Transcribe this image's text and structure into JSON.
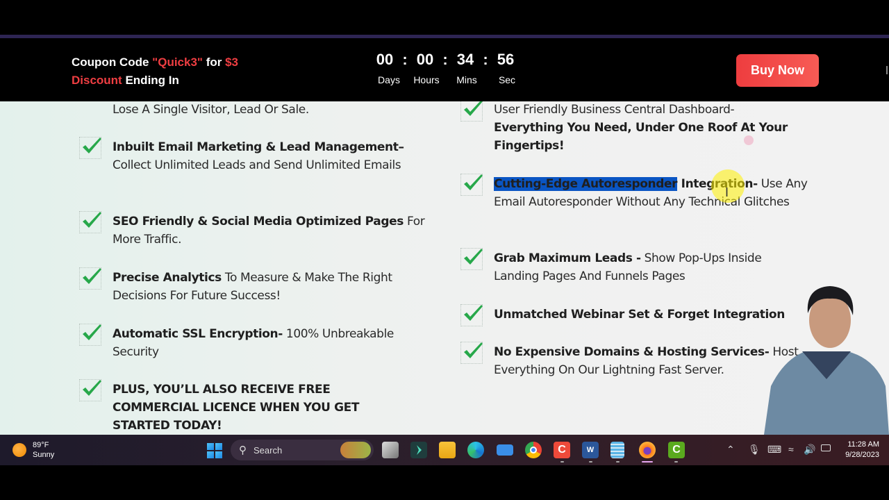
{
  "promo": {
    "coupon_prefix": "Coupon Code ",
    "coupon_code": "\"Quick3\"",
    "coupon_mid": " for ",
    "coupon_amount": "$3",
    "discount_word": "Discount",
    "coupon_suffix": " Ending In",
    "countdown": {
      "days": "00",
      "hours": "00",
      "mins": "34",
      "secs": "56",
      "separator": ":",
      "labels": [
        "Days",
        "Hours",
        "Mins",
        "Sec"
      ]
    },
    "buy_label": "Buy Now",
    "accent_color": "#ef3e42"
  },
  "features_left": [
    {
      "bold": "",
      "text": "Lose A Single Visitor, Lead Or Sale."
    },
    {
      "bold": "Inbuilt Email Marketing & Lead Management–",
      "text": " Collect Unlimited Leads and Send Unlimited Emails"
    },
    {
      "bold": "SEO Friendly & Social Media Optimized Pages",
      "text": " For More Traffic."
    },
    {
      "bold": "Precise Analytics",
      "text": " To Measure & Make The Right Decisions For Future Success!"
    },
    {
      "bold": "Automatic SSL Encryption-",
      "text": " 100% Unbreakable Security"
    },
    {
      "bold": "PLUS, YOU’LL ALSO RECEIVE FREE COMMERCIAL LICENCE WHEN YOU GET STARTED TODAY!",
      "text": ""
    }
  ],
  "features_right": [
    {
      "text": "User Friendly Business Central Dashboard-",
      "bold": "Everything You Need, Under One Roof At Your Fingertips!"
    },
    {
      "selected": "Cutting-Edge Autoresponder",
      "bold": " Integration-",
      "text": " Use Any Email Autoresponder Without Any Technical Glitches"
    },
    {
      "bold": "Grab Maximum Leads -",
      "text": " Show Pop-Ups Inside Landing Pages And Funnels Pages"
    },
    {
      "bold": "Unmatched Webinar Set & Forget Integration",
      "text": ""
    },
    {
      "bold": "No Expensive Domains & Hosting Services-",
      "text": " Host Everything On Our Lightning Fast Server."
    }
  ],
  "taskbar": {
    "weather_temp": "89°F",
    "weather_desc": "Sunny",
    "search_placeholder": "Search",
    "time": "11:28 AM",
    "date": "9/28/2023",
    "apps": [
      "task-view",
      "app-launcher",
      "file-explorer",
      "edge",
      "remote-desktop",
      "chrome",
      "camtasia-recorder",
      "word",
      "notepad",
      "firefox",
      "camtasia-editor"
    ],
    "tray_icons": [
      "chevron-up",
      "microphone",
      "keyboard",
      "wifi",
      "volume",
      "battery"
    ]
  }
}
